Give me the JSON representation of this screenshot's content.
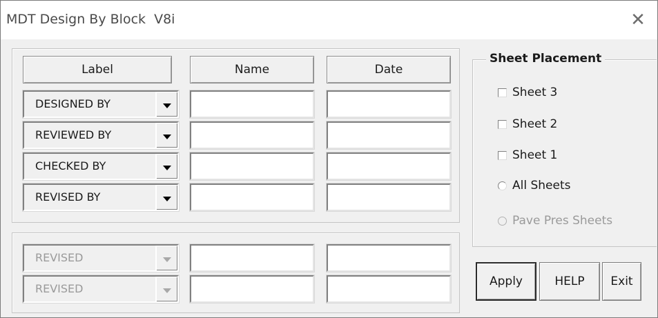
{
  "window": {
    "title": "MDT Design By Block  V8i",
    "close_glyph": "✕"
  },
  "table": {
    "headers": [
      "Label",
      "Name",
      "Date"
    ],
    "rows": [
      {
        "label": "DESIGNED BY",
        "name": "",
        "date": ""
      },
      {
        "label": "REVIEWED BY",
        "name": "",
        "date": ""
      },
      {
        "label": "CHECKED BY",
        "name": "",
        "date": ""
      },
      {
        "label": "REVISED BY",
        "name": "",
        "date": ""
      }
    ],
    "revision_rows": [
      {
        "label": "REVISED",
        "name": "",
        "date": "",
        "enabled": false
      },
      {
        "label": "REVISED",
        "name": "",
        "date": "",
        "enabled": false
      }
    ]
  },
  "sheet_placement": {
    "title": "Sheet Placement",
    "options": [
      {
        "type": "checkbox",
        "label": "Sheet 3",
        "checked": false,
        "enabled": true
      },
      {
        "type": "checkbox",
        "label": "Sheet 2",
        "checked": false,
        "enabled": true
      },
      {
        "type": "checkbox",
        "label": "Sheet 1",
        "checked": false,
        "enabled": true
      },
      {
        "type": "radio",
        "label": "All Sheets",
        "checked": false,
        "enabled": true
      },
      {
        "type": "radio",
        "label": "Pave Pres Sheets",
        "checked": false,
        "enabled": false
      }
    ]
  },
  "buttons": {
    "apply": "Apply",
    "help": "HELP",
    "exit": "Exit"
  },
  "icons": {
    "close": "close-icon",
    "dropdown": "dropdown-arrow-icon",
    "checkbox": "checkbox-icon",
    "radio": "radio-button-icon"
  },
  "colors": {
    "dialog_bg": "#f0f0f0",
    "titlebar_bg": "#ffffff",
    "disabled_text": "#9a9a9a"
  }
}
